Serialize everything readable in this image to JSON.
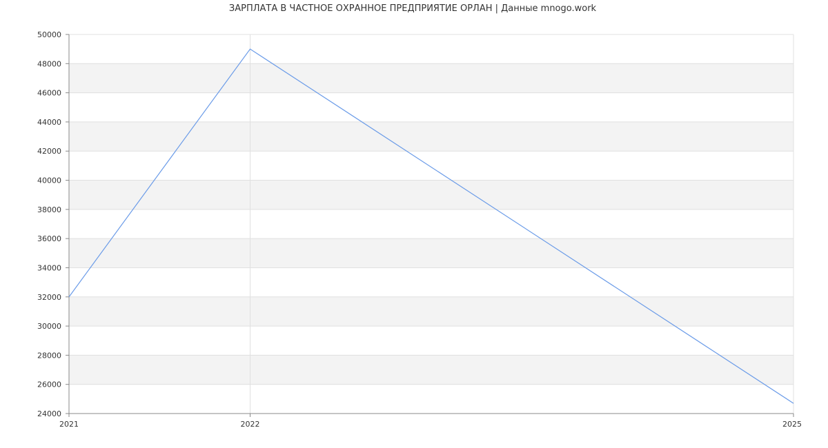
{
  "chart_data": {
    "type": "line",
    "title": "ЗАРПЛАТА В  ЧАСТНОЕ ОХРАННОЕ ПРЕДПРИЯТИЕ ОРЛАН | Данные mnogo.work",
    "x": [
      "2021",
      "2022",
      "2025"
    ],
    "series": [
      {
        "values": [
          32000,
          49000,
          24700
        ]
      }
    ],
    "x_ticks": [
      "2021",
      "2022",
      "2025"
    ],
    "y_ticks": [
      24000,
      26000,
      28000,
      30000,
      32000,
      34000,
      36000,
      38000,
      40000,
      42000,
      44000,
      46000,
      48000,
      50000
    ],
    "ylim": [
      24000,
      50000
    ],
    "xlabel": "",
    "ylabel": "",
    "grid": true,
    "band_color": "#f3f3f3",
    "grid_color": "#e0e0e0",
    "axis_color": "#888888",
    "line_color": "#6a9be8"
  }
}
